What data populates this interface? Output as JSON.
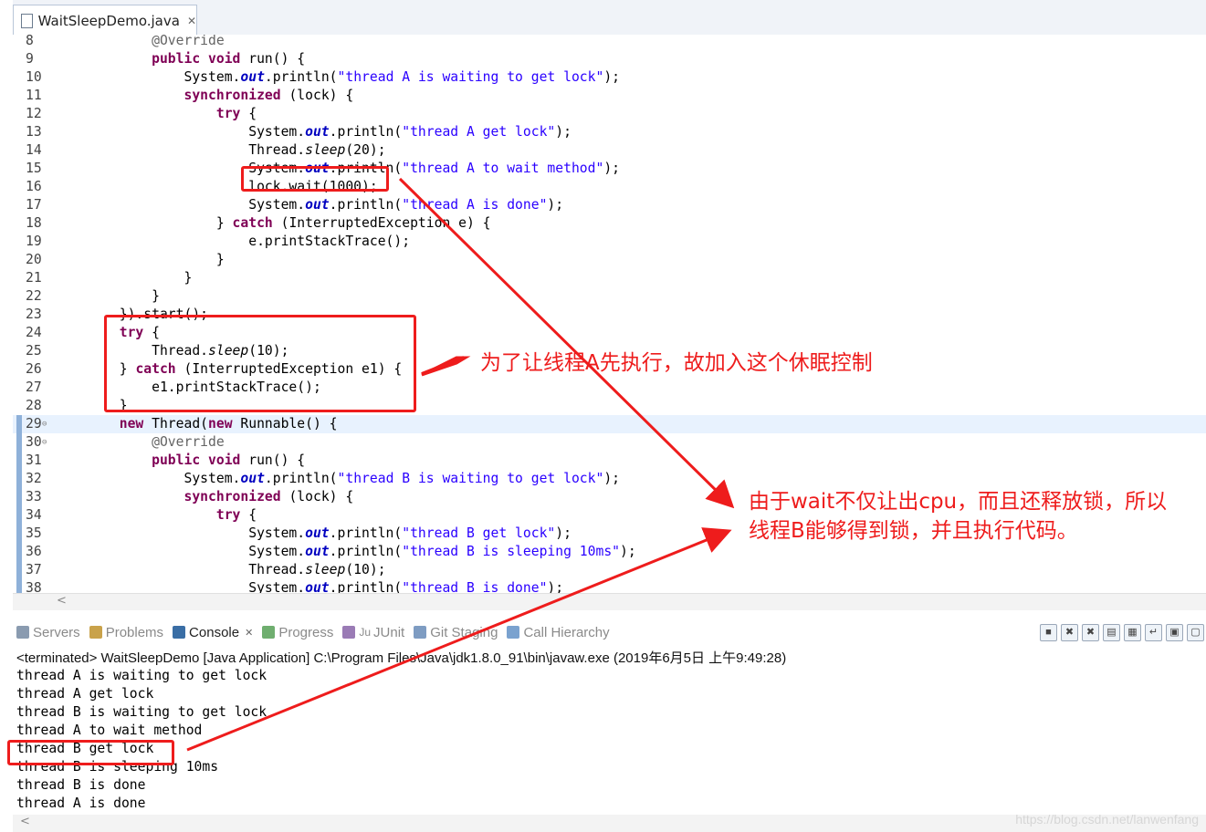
{
  "editor_tab": {
    "title": "WaitSleepDemo.java",
    "close": "✕"
  },
  "code_lines": [
    {
      "n": "8",
      "parts": [
        {
          "t": "            ",
          "c": ""
        },
        {
          "t": "@Override",
          "c": "ann"
        }
      ]
    },
    {
      "n": "9",
      "parts": [
        {
          "t": "            ",
          "c": ""
        },
        {
          "t": "public",
          "c": "kw"
        },
        {
          "t": " ",
          "c": ""
        },
        {
          "t": "void",
          "c": "kw"
        },
        {
          "t": " run() {",
          "c": ""
        }
      ]
    },
    {
      "n": "10",
      "parts": [
        {
          "t": "                System.",
          "c": ""
        },
        {
          "t": "out",
          "c": "fld"
        },
        {
          "t": ".println(",
          "c": ""
        },
        {
          "t": "\"thread A is waiting to get lock\"",
          "c": "str"
        },
        {
          "t": ");",
          "c": ""
        }
      ]
    },
    {
      "n": "11",
      "parts": [
        {
          "t": "                ",
          "c": ""
        },
        {
          "t": "synchronized",
          "c": "kw"
        },
        {
          "t": " (lock) {",
          "c": ""
        }
      ]
    },
    {
      "n": "12",
      "parts": [
        {
          "t": "                    ",
          "c": ""
        },
        {
          "t": "try",
          "c": "kw"
        },
        {
          "t": " {",
          "c": ""
        }
      ]
    },
    {
      "n": "13",
      "parts": [
        {
          "t": "                        System.",
          "c": ""
        },
        {
          "t": "out",
          "c": "fld"
        },
        {
          "t": ".println(",
          "c": ""
        },
        {
          "t": "\"thread A get lock\"",
          "c": "str"
        },
        {
          "t": ");",
          "c": ""
        }
      ]
    },
    {
      "n": "14",
      "parts": [
        {
          "t": "                        Thread.",
          "c": ""
        },
        {
          "t": "sleep",
          "c": "it"
        },
        {
          "t": "(20);",
          "c": ""
        }
      ]
    },
    {
      "n": "15",
      "parts": [
        {
          "t": "                        System.",
          "c": ""
        },
        {
          "t": "out",
          "c": "fld"
        },
        {
          "t": ".println(",
          "c": ""
        },
        {
          "t": "\"thread A to wait method\"",
          "c": "str"
        },
        {
          "t": ");",
          "c": ""
        }
      ]
    },
    {
      "n": "16",
      "parts": [
        {
          "t": "                        lock.wait(1000);",
          "c": ""
        }
      ]
    },
    {
      "n": "17",
      "parts": [
        {
          "t": "                        System.",
          "c": ""
        },
        {
          "t": "out",
          "c": "fld"
        },
        {
          "t": ".println(",
          "c": ""
        },
        {
          "t": "\"thread A is done\"",
          "c": "str"
        },
        {
          "t": ");",
          "c": ""
        }
      ]
    },
    {
      "n": "18",
      "parts": [
        {
          "t": "                    } ",
          "c": ""
        },
        {
          "t": "catch",
          "c": "kw"
        },
        {
          "t": " (InterruptedException e) {",
          "c": ""
        }
      ]
    },
    {
      "n": "19",
      "parts": [
        {
          "t": "                        e.printStackTrace();",
          "c": ""
        }
      ]
    },
    {
      "n": "20",
      "parts": [
        {
          "t": "                    }",
          "c": ""
        }
      ]
    },
    {
      "n": "21",
      "parts": [
        {
          "t": "                }",
          "c": ""
        }
      ]
    },
    {
      "n": "22",
      "parts": [
        {
          "t": "            }",
          "c": ""
        }
      ]
    },
    {
      "n": "23",
      "parts": [
        {
          "t": "        }).start();",
          "c": ""
        }
      ]
    },
    {
      "n": "24",
      "parts": [
        {
          "t": "        ",
          "c": ""
        },
        {
          "t": "try",
          "c": "kw"
        },
        {
          "t": " {",
          "c": ""
        }
      ]
    },
    {
      "n": "25",
      "parts": [
        {
          "t": "            Thread.",
          "c": ""
        },
        {
          "t": "sleep",
          "c": "it"
        },
        {
          "t": "(10);",
          "c": ""
        }
      ]
    },
    {
      "n": "26",
      "parts": [
        {
          "t": "        } ",
          "c": ""
        },
        {
          "t": "catch",
          "c": "kw"
        },
        {
          "t": " (InterruptedException e1) {",
          "c": ""
        }
      ]
    },
    {
      "n": "27",
      "parts": [
        {
          "t": "            e1.printStackTrace();",
          "c": ""
        }
      ]
    },
    {
      "n": "28",
      "parts": [
        {
          "t": "        }",
          "c": ""
        }
      ]
    },
    {
      "n": "29",
      "parts": [
        {
          "t": "        ",
          "c": ""
        },
        {
          "t": "new",
          "c": "kw"
        },
        {
          "t": " Thread(",
          "c": ""
        },
        {
          "t": "new",
          "c": "kw"
        },
        {
          "t": " Runnable() {",
          "c": ""
        }
      ]
    },
    {
      "n": "30",
      "parts": [
        {
          "t": "            ",
          "c": ""
        },
        {
          "t": "@Override",
          "c": "ann"
        }
      ]
    },
    {
      "n": "31",
      "parts": [
        {
          "t": "            ",
          "c": ""
        },
        {
          "t": "public",
          "c": "kw"
        },
        {
          "t": " ",
          "c": ""
        },
        {
          "t": "void",
          "c": "kw"
        },
        {
          "t": " run() {",
          "c": ""
        }
      ]
    },
    {
      "n": "32",
      "parts": [
        {
          "t": "                System.",
          "c": ""
        },
        {
          "t": "out",
          "c": "fld"
        },
        {
          "t": ".println(",
          "c": ""
        },
        {
          "t": "\"thread B is waiting to get lock\"",
          "c": "str"
        },
        {
          "t": ");",
          "c": ""
        }
      ]
    },
    {
      "n": "33",
      "parts": [
        {
          "t": "                ",
          "c": ""
        },
        {
          "t": "synchronized",
          "c": "kw"
        },
        {
          "t": " (lock) {",
          "c": ""
        }
      ]
    },
    {
      "n": "34",
      "parts": [
        {
          "t": "                    ",
          "c": ""
        },
        {
          "t": "try",
          "c": "kw"
        },
        {
          "t": " {",
          "c": ""
        }
      ]
    },
    {
      "n": "35",
      "parts": [
        {
          "t": "                        System.",
          "c": ""
        },
        {
          "t": "out",
          "c": "fld"
        },
        {
          "t": ".println(",
          "c": ""
        },
        {
          "t": "\"thread B get lock\"",
          "c": "str"
        },
        {
          "t": ");",
          "c": ""
        }
      ]
    },
    {
      "n": "36",
      "parts": [
        {
          "t": "                        System.",
          "c": ""
        },
        {
          "t": "out",
          "c": "fld"
        },
        {
          "t": ".println(",
          "c": ""
        },
        {
          "t": "\"thread B is sleeping 10ms\"",
          "c": "str"
        },
        {
          "t": ");",
          "c": ""
        }
      ]
    },
    {
      "n": "37",
      "parts": [
        {
          "t": "                        Thread.",
          "c": ""
        },
        {
          "t": "sleep",
          "c": "it"
        },
        {
          "t": "(10);",
          "c": ""
        }
      ]
    },
    {
      "n": "38",
      "parts": [
        {
          "t": "                        System.",
          "c": ""
        },
        {
          "t": "out",
          "c": "fld"
        },
        {
          "t": ".println(",
          "c": ""
        },
        {
          "t": "\"thread B is done\"",
          "c": "str"
        },
        {
          "t": ");",
          "c": ""
        }
      ]
    }
  ],
  "views": [
    {
      "label": "Servers",
      "icon": "servers-icon",
      "color": "#8a9bb0"
    },
    {
      "label": "Problems",
      "icon": "problems-icon",
      "color": "#c9a24a"
    },
    {
      "label": "Console",
      "icon": "console-icon",
      "color": "#3a6ea5",
      "active": true,
      "close": "✕"
    },
    {
      "label": "Progress",
      "icon": "progress-icon",
      "color": "#6fae6f"
    },
    {
      "label": "JUnit",
      "icon": "junit-icon",
      "color": "#9a7bb5",
      "prefix": "Ju"
    },
    {
      "label": "Git Staging",
      "icon": "git-staging-icon",
      "color": "#7e9cc2"
    },
    {
      "label": "Call Hierarchy",
      "icon": "call-hierarchy-icon",
      "color": "#7aa2cf"
    }
  ],
  "console": {
    "header": "<terminated> WaitSleepDemo [Java Application] C:\\Program Files\\Java\\jdk1.8.0_91\\bin\\javaw.exe (2019年6月5日 上午9:49:28)",
    "lines": [
      "thread A is waiting to get lock",
      "thread A get lock",
      "thread B is waiting to get lock",
      "thread A to wait method",
      "thread B get lock",
      "thread B is sleeping 10ms",
      "thread B is done",
      "thread A is done"
    ]
  },
  "annotations": {
    "note1": "为了让线程A先执行，故加入这个休眠控制",
    "note2_line1": "由于wait不仅让出cpu，而且还释放锁，所以",
    "note2_line2": "线程B能够得到锁，并且执行代码。",
    "color": "#ee1c1c"
  },
  "watermark": "https://blog.csdn.net/lanwenfang"
}
